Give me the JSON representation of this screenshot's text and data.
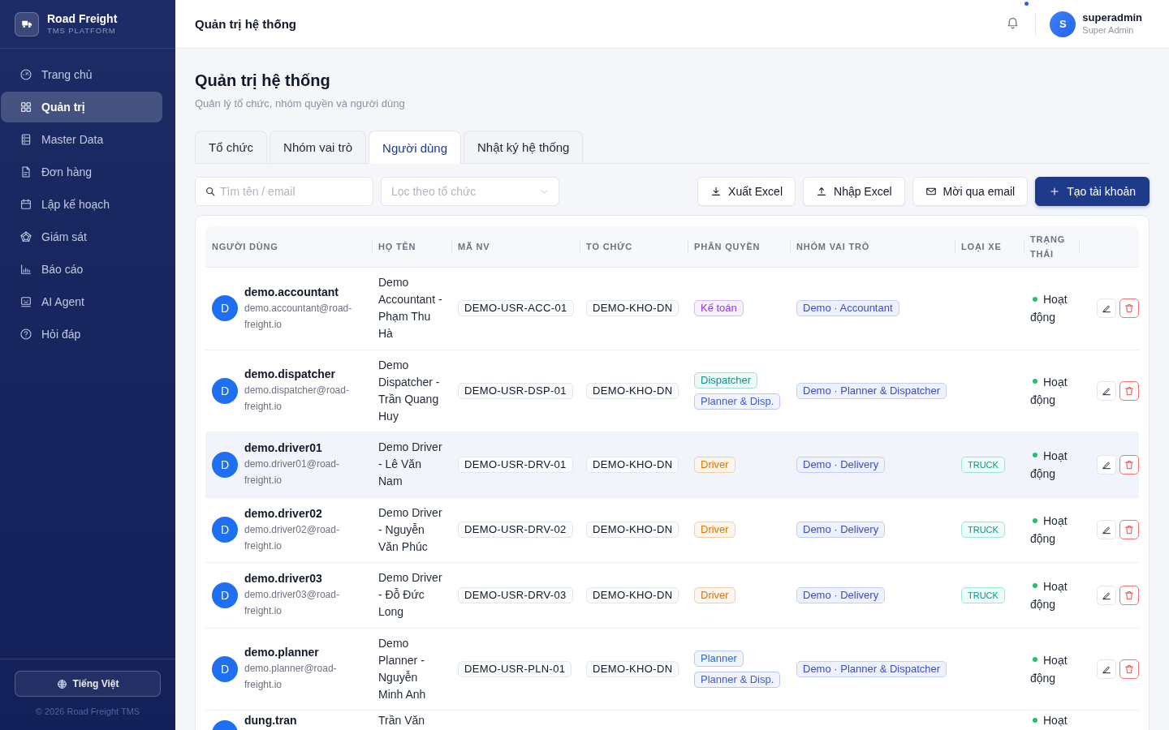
{
  "sidebar": {
    "brand": {
      "name": "Road Freight",
      "tagline": "TMS PLATFORM"
    },
    "items": [
      {
        "label": "Trang chủ",
        "selected": false
      },
      {
        "label": "Quản trị",
        "selected": true
      },
      {
        "label": "Master Data",
        "selected": false
      },
      {
        "label": "Đơn hàng",
        "selected": false
      },
      {
        "label": "Lập kế hoạch",
        "selected": false
      },
      {
        "label": "Giám sát",
        "selected": false
      },
      {
        "label": "Báo cáo",
        "selected": false
      },
      {
        "label": "AI Agent",
        "selected": false
      },
      {
        "label": "Hỏi đáp",
        "selected": false
      }
    ],
    "language_button": {
      "label": "Tiếng Việt"
    },
    "copyright": "© 2026 Road Freight TMS"
  },
  "header": {
    "title": "Quản trị hệ thống",
    "notifications": {
      "unread": true
    },
    "user": {
      "initial": "S",
      "name": "superadmin",
      "role": "Super Admin"
    }
  },
  "page": {
    "title": "Quản trị hệ thống",
    "subtitle": "Quản lý tổ chức, nhóm quyền và người dùng"
  },
  "tabs": [
    {
      "label": "Tổ chức",
      "selected": false
    },
    {
      "label": "Nhóm vai trò",
      "selected": false
    },
    {
      "label": "Người dùng",
      "selected": true
    },
    {
      "label": "Nhật ký hệ thống",
      "selected": false
    }
  ],
  "toolbar": {
    "search": {
      "placeholder": "Tìm tên / email"
    },
    "organization_filter": {
      "placeholder": "Lọc theo tổ chức"
    },
    "buttons": [
      {
        "label": "Xuất Excel",
        "kind": "export"
      },
      {
        "label": "Nhập Excel",
        "kind": "import"
      },
      {
        "label": "Mời qua email",
        "kind": "invite"
      },
      {
        "label": "Tạo tài khoản",
        "kind": "create"
      }
    ]
  },
  "table": {
    "columns": [
      "NGƯỜI DÙNG",
      "HỌ TÊN",
      "MÃ NV",
      "TỔ CHỨC",
      "PHÂN QUYỀN",
      "NHÓM VAI TRÒ",
      "LOẠI XE",
      "TRẠNG THÁI"
    ],
    "rows": [
      {
        "kind": "full",
        "highlighted": false,
        "avatar": "D",
        "username": "demo.accountant",
        "email": "demo.accountant@road-freight.io",
        "full_name": "Demo Accountant - Phạm Thu Hà",
        "employee_code": "DEMO-USR-ACC-01",
        "organization": "DEMO-KHO-DN",
        "permissions": [
          {
            "label": "Kế toán",
            "color": "#9333ea"
          }
        ],
        "role_group": "Demo · Accountant",
        "status": {
          "label": "Hoạt động",
          "active": true
        }
      },
      {
        "kind": "full",
        "highlighted": false,
        "avatar": "D",
        "username": "demo.dispatcher",
        "email": "demo.dispatcher@road-freight.io",
        "full_name": "Demo Dispatcher - Trần Quang Huy",
        "employee_code": "DEMO-USR-DSP-01",
        "organization": "DEMO-KHO-DN",
        "permissions": [
          {
            "label": "Dispatcher",
            "color": "#0d9488"
          },
          {
            "label": "Planner & Disp.",
            "color": "#3b5bdb"
          }
        ],
        "role_group": "Demo · Planner & Dispatcher",
        "status": {
          "label": "Hoạt động",
          "active": true
        }
      },
      {
        "kind": "full",
        "highlighted": true,
        "avatar": "D",
        "username": "demo.driver01",
        "email": "demo.driver01@road-freight.io",
        "full_name": "Demo Driver - Lê Văn Nam",
        "employee_code": "DEMO-USR-DRV-01",
        "organization": "DEMO-KHO-DN",
        "permissions": [
          {
            "label": "Driver",
            "color": "#d97706"
          }
        ],
        "role_group": "Demo · Delivery",
        "vehicle_type": "TRUCK",
        "status": {
          "label": "Hoạt động",
          "active": true
        }
      },
      {
        "kind": "full",
        "highlighted": false,
        "avatar": "D",
        "username": "demo.driver02",
        "email": "demo.driver02@road-freight.io",
        "full_name": "Demo Driver - Nguyễn Văn Phúc",
        "employee_code": "DEMO-USR-DRV-02",
        "organization": "DEMO-KHO-DN",
        "permissions": [
          {
            "label": "Driver",
            "color": "#d97706"
          }
        ],
        "role_group": "Demo · Delivery",
        "vehicle_type": "TRUCK",
        "status": {
          "label": "Hoạt động",
          "active": true
        }
      },
      {
        "kind": "full",
        "highlighted": false,
        "avatar": "D",
        "username": "demo.driver03",
        "email": "demo.driver03@road-freight.io",
        "full_name": "Demo Driver - Đỗ Đức Long",
        "employee_code": "DEMO-USR-DRV-03",
        "organization": "DEMO-KHO-DN",
        "permissions": [
          {
            "label": "Driver",
            "color": "#d97706"
          }
        ],
        "role_group": "Demo · Delivery",
        "vehicle_type": "TRUCK",
        "status": {
          "label": "Hoạt động",
          "active": true
        }
      },
      {
        "kind": "full",
        "highlighted": false,
        "avatar": "D",
        "username": "demo.planner",
        "email": "demo.planner@road-freight.io",
        "full_name": "Demo Planner - Nguyễn Minh Anh",
        "employee_code": "DEMO-USR-PLN-01",
        "organization": "DEMO-KHO-DN",
        "permissions": [
          {
            "label": "Planner",
            "color": "#2b6cd6"
          },
          {
            "label": "Planner & Disp.",
            "color": "#3b5bdb"
          }
        ],
        "role_group": "Demo · Planner & Dispatcher",
        "status": {
          "label": "Hoạt động",
          "active": true
        }
      },
      {
        "kind": "clipped",
        "highlighted": false,
        "username": "dung.tran",
        "full_name": "Trần Văn",
        "status": {
          "label": "Hoạt",
          "active": true
        }
      }
    ]
  }
}
